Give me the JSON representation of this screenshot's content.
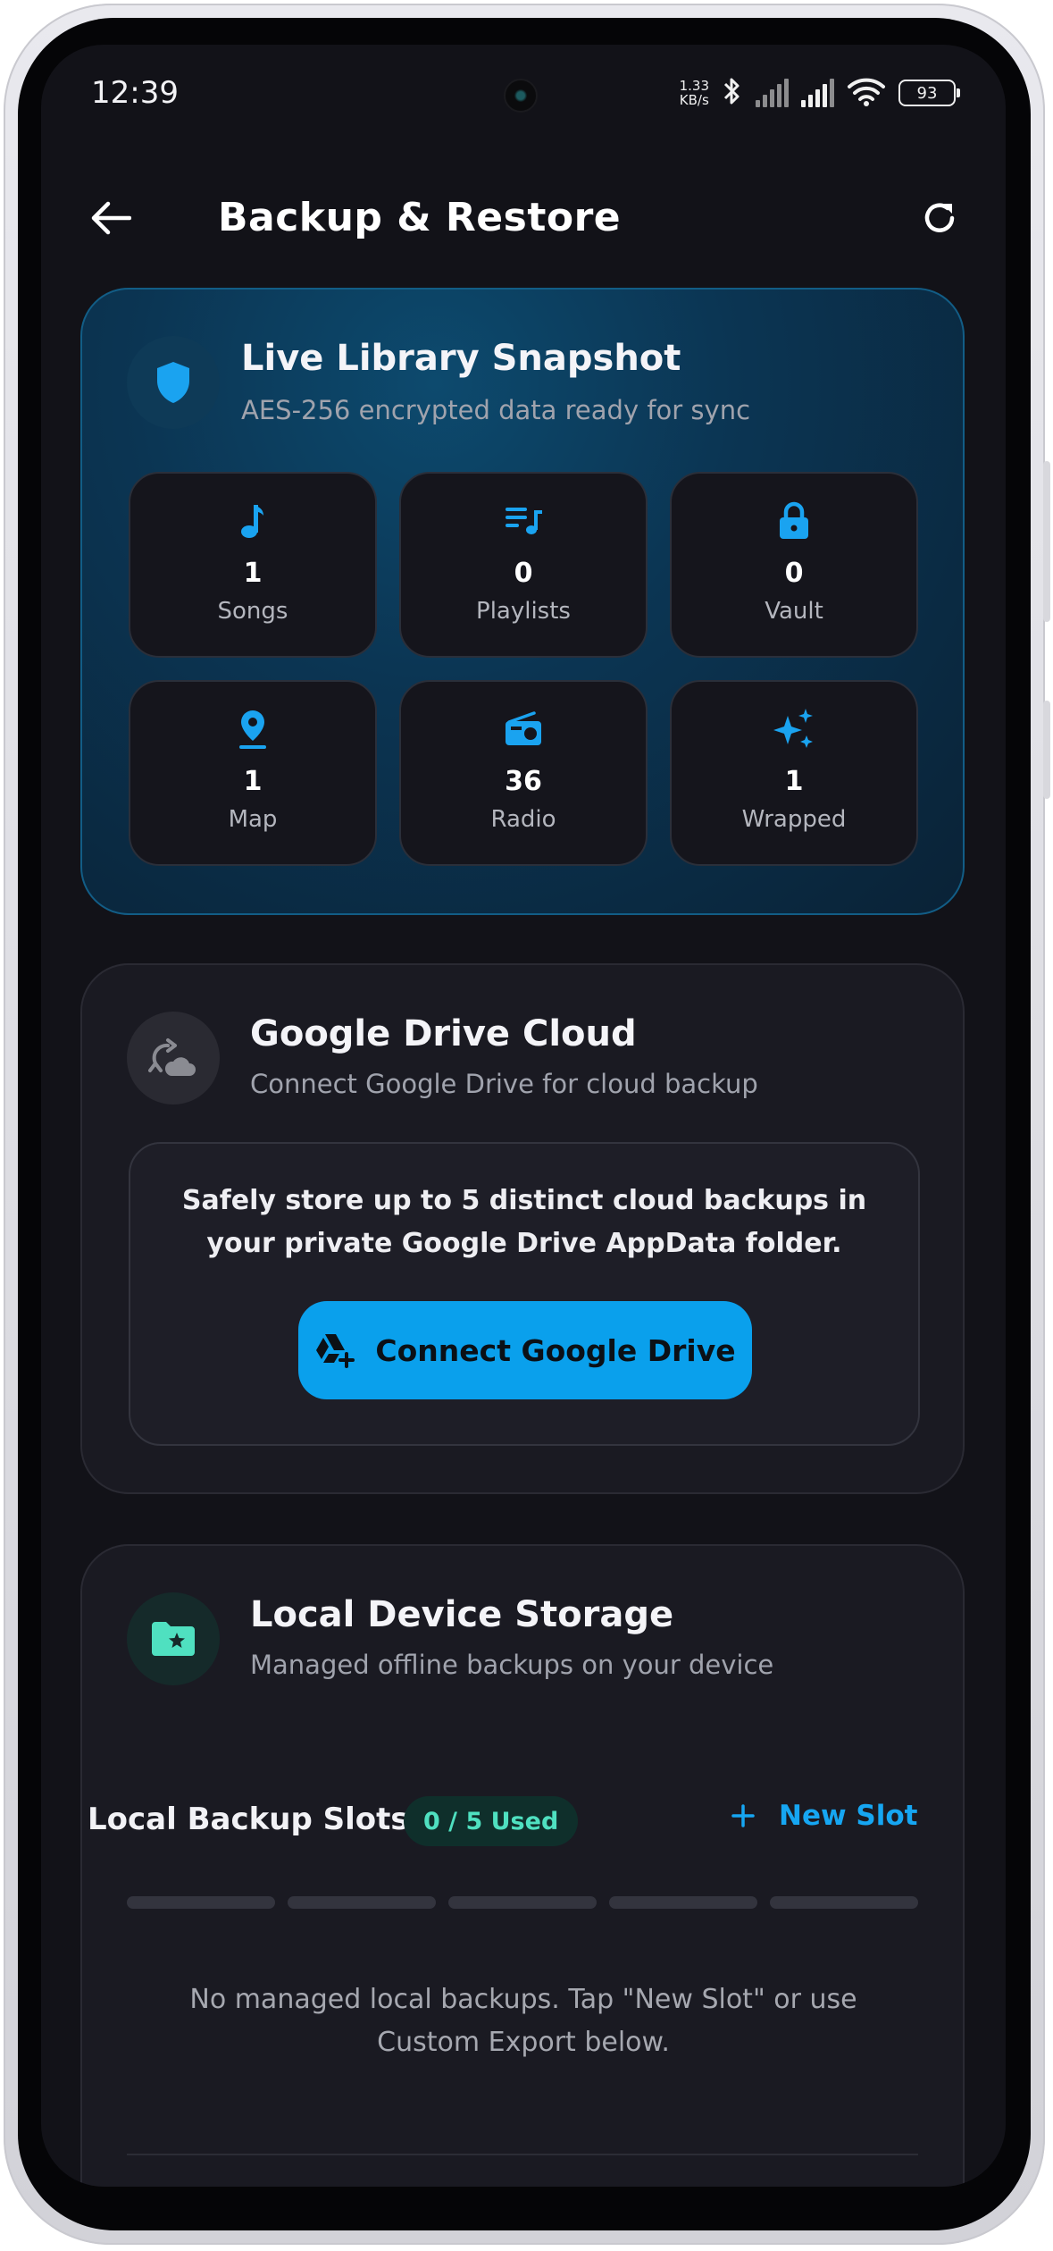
{
  "status_bar": {
    "time": "12:39",
    "net_speed_value": "1.33",
    "net_speed_unit": "KB/s",
    "battery": "93"
  },
  "app_bar": {
    "title": "Backup & Restore",
    "back_icon": "arrow-left-icon",
    "refresh_icon": "refresh-icon"
  },
  "snapshot": {
    "title": "Live Library Snapshot",
    "subtitle": "AES-256 encrypted data ready for sync",
    "icon": "shield-icon",
    "accent": "#1aa3f0",
    "stats": [
      {
        "icon": "music-note-icon",
        "value": "1",
        "label": "Songs"
      },
      {
        "icon": "playlist-icon",
        "value": "0",
        "label": "Playlists"
      },
      {
        "icon": "lock-icon",
        "value": "0",
        "label": "Vault"
      },
      {
        "icon": "location-pin-icon",
        "value": "1",
        "label": "Map"
      },
      {
        "icon": "radio-icon",
        "value": "36",
        "label": "Radio"
      },
      {
        "icon": "sparkles-icon",
        "value": "1",
        "label": "Wrapped"
      }
    ]
  },
  "drive": {
    "title": "Google Drive Cloud",
    "subtitle": "Connect Google Drive for cloud backup",
    "icon": "cloud-sync-icon",
    "description": "Safely store up to 5 distinct cloud backups in your private Google Drive AppData folder.",
    "button_label": "Connect Google Drive",
    "button_icon": "drive-add-icon",
    "button_color": "#0aa0ec"
  },
  "local": {
    "title": "Local Device Storage",
    "subtitle": "Managed offline backups on your device",
    "icon": "folder-star-icon",
    "slots_label": "Local Backup Slots",
    "slots_badge": "0 / 5 Used",
    "slots_used": 0,
    "slots_total": 5,
    "new_slot_label": "New Slot",
    "empty_message": "No managed local backups. Tap \"New Slot\" or use Custom Export below.",
    "badge_color": "#4fe0c0"
  }
}
